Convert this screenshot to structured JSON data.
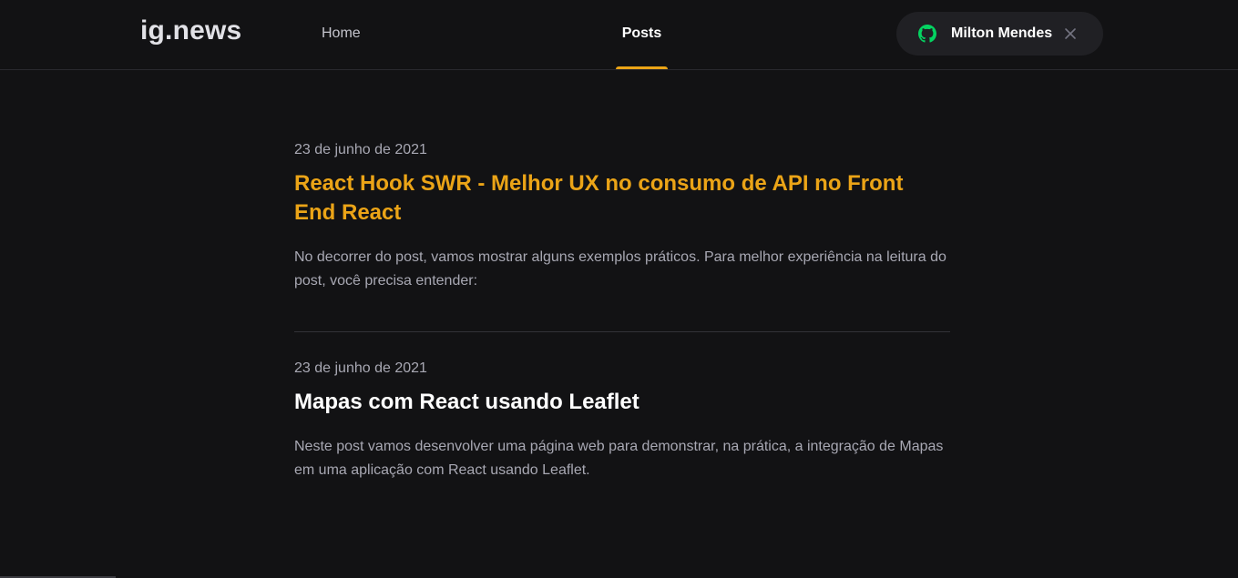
{
  "header": {
    "logo": "ig.news",
    "nav": [
      {
        "label": "Home",
        "active": false
      },
      {
        "label": "Posts",
        "active": true
      }
    ],
    "user": {
      "name": "Milton Mendes",
      "icon": "github-icon",
      "icon_color": "#04d361",
      "close_icon": "close-icon"
    }
  },
  "colors": {
    "background": "#121214",
    "accent": "#eba417",
    "text": "#e1e1e6",
    "muted": "#a8a8b3"
  },
  "posts": [
    {
      "date": "23 de junho de 2021",
      "title": "React Hook SWR - Melhor UX no consumo de API no Front End React",
      "excerpt": "No decorrer do post, vamos mostrar alguns exemplos práticos. Para melhor experiência na leitura do post, você precisa entender:"
    },
    {
      "date": "23 de junho de 2021",
      "title": "Mapas com React usando Leaflet",
      "excerpt": "Neste post vamos desenvolver uma página web para demonstrar, na prática, a integração de Mapas em uma aplicação com React usando Leaflet."
    }
  ]
}
